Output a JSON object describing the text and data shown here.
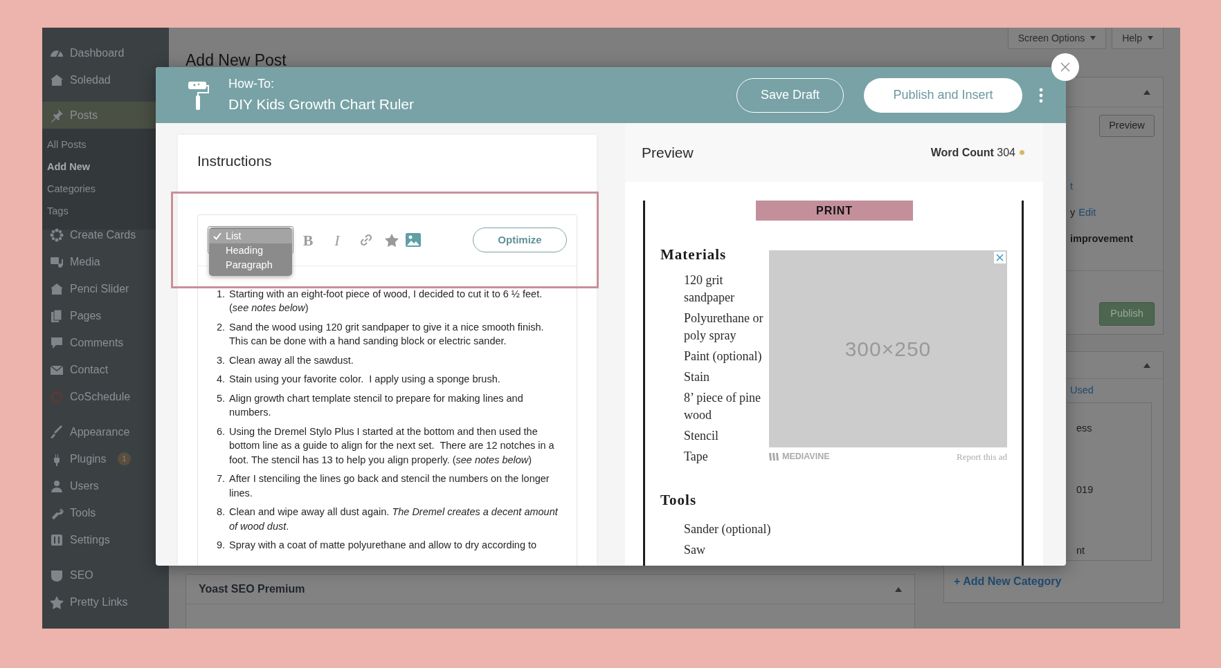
{
  "sidebar": {
    "groups": [
      [
        {
          "label": "Dashboard",
          "selected": false
        },
        {
          "label": "Soledad",
          "selected": false
        }
      ],
      [
        {
          "label": "Posts",
          "selected": true,
          "children": [
            {
              "label": "All Posts",
              "selected": false
            },
            {
              "label": "Add New",
              "selected": true
            },
            {
              "label": "Categories",
              "selected": false
            },
            {
              "label": "Tags",
              "selected": false
            }
          ]
        },
        {
          "label": "Create Cards",
          "selected": false
        },
        {
          "label": "Media",
          "selected": false
        },
        {
          "label": "Penci Slider",
          "selected": false
        },
        {
          "label": "Pages",
          "selected": false
        },
        {
          "label": "Comments",
          "selected": false
        },
        {
          "label": "Contact",
          "selected": false
        },
        {
          "label": "CoSchedule",
          "selected": false
        }
      ],
      [
        {
          "label": "Appearance",
          "selected": false
        },
        {
          "label": "Plugins",
          "selected": false,
          "badge": "1"
        },
        {
          "label": "Users",
          "selected": false
        },
        {
          "label": "Tools",
          "selected": false
        },
        {
          "label": "Settings",
          "selected": false
        }
      ],
      [
        {
          "label": "SEO",
          "selected": false
        },
        {
          "label": "Pretty Links",
          "selected": false
        }
      ]
    ]
  },
  "page": {
    "title": "Add New Post",
    "screen_options": "Screen Options",
    "help": "Help"
  },
  "publish_box": {
    "preview_button": "Preview",
    "lines": [
      [
        {
          "kind": "link",
          "text": "t"
        }
      ],
      [
        {
          "kind": "plain",
          "text": "y"
        },
        {
          "kind": "link",
          "text": "Edit"
        }
      ],
      [
        {
          "kind": "bold",
          "text": "improvement"
        }
      ]
    ],
    "publish_button": "Publish"
  },
  "categories_box": {
    "tab": "Used",
    "items": [
      "ess",
      "019",
      "nt"
    ],
    "add_link": "+ Add New Category"
  },
  "yoast_box": {
    "title": "Yoast SEO Premium"
  },
  "modal": {
    "type_label": "How-To:",
    "title": "DIY Kids Growth Chart Ruler",
    "save_button": "Save Draft",
    "publish_button": "Publish and Insert",
    "instructions": {
      "heading": "Instructions",
      "format_menu": [
        {
          "label": "List",
          "selected": true
        },
        {
          "label": "Heading",
          "selected": false
        },
        {
          "label": "Paragraph",
          "selected": false
        }
      ],
      "toolbar": [
        {
          "kind": "bold",
          "label": "B"
        },
        {
          "kind": "italic",
          "label": "I"
        },
        {
          "kind": "link"
        },
        {
          "kind": "star"
        },
        {
          "kind": "image"
        }
      ],
      "optimize_button": "Optimize",
      "steps": [
        {
          "number": "1.",
          "text": "Starting with an eight-foot piece of wood, I decided to cut it to 6 ½ feet. (*see notes below*)"
        },
        {
          "number": "2.",
          "text": "Sand the wood using 120 grit sandpaper to give it a nice smooth finish. This can be done with a hand sanding block or electric sander."
        },
        {
          "number": "3.",
          "text": "Clean away all the sawdust."
        },
        {
          "number": "4.",
          "text": "Stain using your favorite color.  I apply using a sponge brush."
        },
        {
          "number": "5.",
          "text": "Align growth chart template stencil to prepare for making lines and numbers."
        },
        {
          "number": "6.",
          "text": "Using the Dremel Stylo Plus I started at the bottom and then used the bottom line as a guide to align for the next set.  There are 12 notches in a foot. The stencil has 13 to help you align properly. (*see notes below*)"
        },
        {
          "number": "7.",
          "text": "After I stenciling the lines go back and stencil the numbers on the longer lines."
        },
        {
          "number": "8.",
          "text": "Clean and wipe away all dust again. *The Dremel creates a decent amount of wood dust*."
        },
        {
          "number": "9.",
          "text": "Spray with a coat of matte polyurethane and allow to dry according to"
        }
      ]
    },
    "preview": {
      "heading": "Preview",
      "word_count_label": "Word Count",
      "word_count": "304",
      "print_button": "PRINT",
      "sections": [
        {
          "heading": "Materials",
          "items": [
            "120 grit sandpaper",
            "Polyurethane or poly spray",
            "Paint (optional)",
            "Stain",
            "8’ piece of pine wood",
            "Stencil",
            "Tape"
          ]
        },
        {
          "heading": "Tools",
          "items": [
            "Sander (optional)",
            "Saw"
          ]
        }
      ],
      "ad": {
        "size": "300×250",
        "brand": "MEDIAVINE",
        "report": "Report this ad"
      }
    }
  }
}
